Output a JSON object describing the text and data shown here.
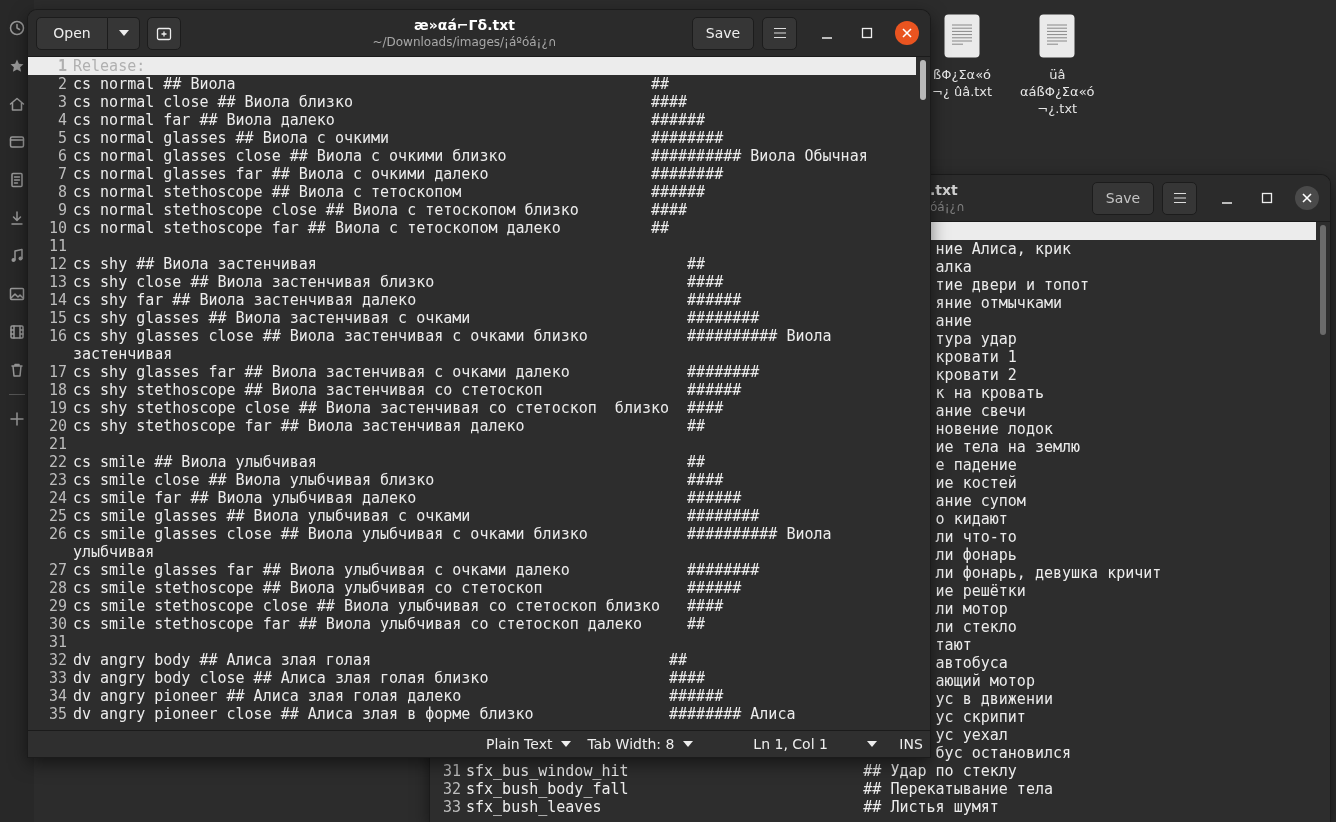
{
  "desktop_icons": [
    {
      "label_lines": [
        "ßΦ¿Σα«ó",
        "¬¿ ûâ.txt"
      ]
    },
    {
      "label_lines": [
        "üâ",
        "αáßΦ¿Σα«ó",
        "¬¿.txt"
      ]
    }
  ],
  "back_window": {
    "focused": false,
    "title": ".txt",
    "subtitle": "óá¡¿∩",
    "save_button": "Save",
    "lines": [
      {
        "current": true
      },
      {
        "current": false,
        "fragment": "ние Алиса, крик"
      },
      {
        "current": false,
        "fragment": "алка"
      },
      {
        "current": false,
        "fragment": "тие двери и топот"
      },
      {
        "current": false,
        "fragment": "яние отмычками"
      },
      {
        "current": false,
        "fragment": "ание"
      },
      {
        "current": false,
        "fragment": "тура удар"
      },
      {
        "current": false,
        "fragment": "кровати 1"
      },
      {
        "current": false,
        "fragment": "кровати 2"
      },
      {
        "current": false,
        "fragment": "к на кровать"
      },
      {
        "current": false,
        "fragment": "ание свечи"
      },
      {
        "current": false,
        "fragment": "новение лодок"
      },
      {
        "current": false,
        "fragment": "ие тела на землю"
      },
      {
        "current": false,
        "fragment": "е падение"
      },
      {
        "current": false,
        "fragment": "ие костей"
      },
      {
        "current": false,
        "fragment": "ание супом"
      },
      {
        "current": false,
        "fragment": "о кидают"
      },
      {
        "current": false,
        "fragment": "ли что-то"
      },
      {
        "current": false,
        "fragment": "ли фонарь"
      },
      {
        "current": false,
        "fragment": "ли фонарь, девушка кричит"
      },
      {
        "current": false,
        "fragment": "ие решётки"
      },
      {
        "current": false,
        "fragment": "ли мотор"
      },
      {
        "current": false,
        "fragment": "ли стекло"
      },
      {
        "current": false,
        "fragment": "тают"
      },
      {
        "current": false,
        "fragment": "автобуса"
      },
      {
        "current": false,
        "fragment": "ающий мотор"
      },
      {
        "current": false,
        "fragment": "ус в движении"
      },
      {
        "current": false,
        "fragment": "ус скрипит"
      },
      {
        "current": false,
        "fragment": "ус уехал"
      },
      {
        "current": false,
        "fragment": "бус остановился"
      },
      {
        "current": false,
        "number": "31",
        "text": "sfx_bus_window_hit",
        "comment": "## Удар по стеклу"
      },
      {
        "current": false,
        "number": "32",
        "text": "sfx_bush_body_fall",
        "comment": "## Перекатывание тела"
      },
      {
        "current": false,
        "number": "33",
        "text": "sfx_bush_leaves",
        "comment": "## Листья шумят"
      }
    ]
  },
  "main_window": {
    "focused": true,
    "open_button": "Open",
    "title": "æ»αá⌐Γδ.txt",
    "subtitle": "~/Downloads/images/¡áºóá¡¿∩",
    "save_button": "Save",
    "lines": [
      {
        "number": "1",
        "current": true,
        "text": "Release:"
      },
      {
        "number": "2",
        "current": false,
        "text": "cs normal ## Виола",
        "comment": "##"
      },
      {
        "number": "3",
        "current": false,
        "text": "cs normal close ## Виола близко",
        "comment": "####"
      },
      {
        "number": "4",
        "current": false,
        "text": "cs normal far ## Виола далеко",
        "comment": "######"
      },
      {
        "number": "5",
        "current": false,
        "text": "cs normal glasses ## Виола с очкими",
        "comment": "########"
      },
      {
        "number": "6",
        "current": false,
        "text": "cs normal glasses close ## Виола с очкими близко",
        "comment": "########## Виола Обычная"
      },
      {
        "number": "7",
        "current": false,
        "text": "cs normal glasses far ## Виола с очкими далеко",
        "comment": "########"
      },
      {
        "number": "8",
        "current": false,
        "text": "cs normal stethoscope ## Виола с тетоскопом",
        "comment": "######"
      },
      {
        "number": "9",
        "current": false,
        "text": "cs normal stethoscope close ## Виола с тетоскопом близко",
        "comment": "####"
      },
      {
        "number": "10",
        "current": false,
        "text": "cs normal stethoscope far ## Виола с тетоскопом далеко",
        "comment": "##"
      },
      {
        "number": "11",
        "current": false
      },
      {
        "number": "12",
        "current": false,
        "text": "cs shy ## Виола застенчивая",
        "comment": "##"
      },
      {
        "number": "13",
        "current": false,
        "text": "cs shy close ## Виола застенчивая близко",
        "comment": "####"
      },
      {
        "number": "14",
        "current": false,
        "text": "cs shy far ## Виола застенчивая далеко",
        "comment": "######"
      },
      {
        "number": "15",
        "current": false,
        "text": "cs shy glasses ## Виола застенчивая с очками",
        "comment": "########"
      },
      {
        "number": "16",
        "current": false,
        "text": "cs shy glasses close ## Виола застенчивая с очками близко",
        "comment": "########## Виола застенчивая"
      },
      {
        "number": "17",
        "current": false,
        "text": "cs shy glasses far ## Виола застенчивая с очками далеко",
        "comment": "########"
      },
      {
        "number": "18",
        "current": false,
        "text": "cs shy stethoscope ## Виола застенчивая со стетоскоп",
        "comment": "######"
      },
      {
        "number": "19",
        "current": false,
        "text": "cs shy stethoscope close ## Виола застенчивая со стетоскоп  близко",
        "comment": "####"
      },
      {
        "number": "20",
        "current": false,
        "text": "cs shy stethoscope far ## Виола застенчивая далеко",
        "comment": "##"
      },
      {
        "number": "21",
        "current": false
      },
      {
        "number": "22",
        "current": false,
        "text": "cs smile ## Виола улыбчивая",
        "comment": "##"
      },
      {
        "number": "23",
        "current": false,
        "text": "cs smile close ## Виола улыбчивая близко",
        "comment": "####"
      },
      {
        "number": "24",
        "current": false,
        "text": "cs smile far ## Виола улыбчивая далеко",
        "comment": "######"
      },
      {
        "number": "25",
        "current": false,
        "text": "cs smile glasses ## Виола улыбчивая с очками",
        "comment": "########"
      },
      {
        "number": "26",
        "current": false,
        "text": "cs smile glasses close ## Виола улыбчивая с очками близко",
        "comment": "########## Виола улыбчивая"
      },
      {
        "number": "27",
        "current": false,
        "text": "cs smile glasses far ## Виола улыбчивая с очками далеко",
        "comment": "########"
      },
      {
        "number": "28",
        "current": false,
        "text": "cs smile stethoscope ## Виола улыбчивая со стетоскоп",
        "comment": "######"
      },
      {
        "number": "29",
        "current": false,
        "text": "cs smile stethoscope close ## Виола улыбчивая со стетоскоп близко",
        "comment": "####"
      },
      {
        "number": "30",
        "current": false,
        "text": "cs smile stethoscope far ## Виола улыбчивая со стетоскоп далеко",
        "comment": "##"
      },
      {
        "number": "31",
        "current": false
      },
      {
        "number": "32",
        "current": false,
        "text": "dv angry body ## Алиса злая голая",
        "comment": "##"
      },
      {
        "number": "33",
        "current": false,
        "text": "dv angry body close ## Алиса злая голая близко",
        "comment": "####"
      },
      {
        "number": "34",
        "current": false,
        "text": "dv angry pioneer ## Алиса злая голая далеко",
        "comment": "######"
      },
      {
        "number": "35",
        "current": false,
        "text": "dv angry pioneer close ## Алиса злая в форме близко",
        "comment": "######## Алиса"
      }
    ],
    "status_bar": {
      "language": "Plain Text",
      "tab_width": "Tab Width: 8",
      "cursor_position": "Ln 1, Col 1",
      "mode": "INS"
    }
  }
}
